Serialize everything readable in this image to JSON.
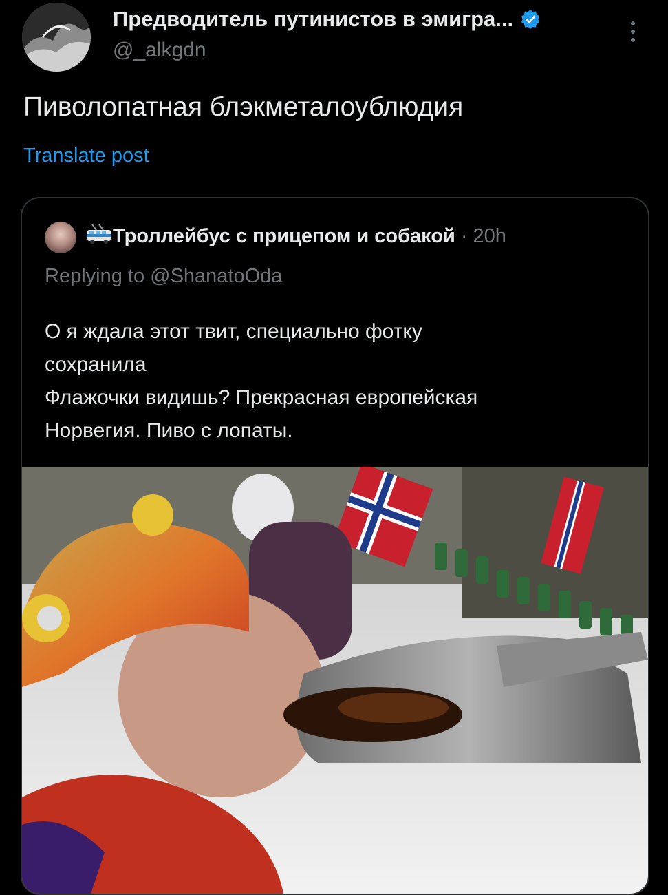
{
  "post": {
    "author_name": "Предводитель путинистов в эмигра...",
    "handle": "@_alkgdn",
    "text": "Пиволопатная блэкметалоублюдия",
    "translate_label": "Translate post"
  },
  "quote": {
    "author_name": "Троллейбус с прицепом и собакой",
    "separator": "·",
    "time": "20h",
    "reply_line": "Replying to @ShanatoOda",
    "text_lines": [
      "О я ждала этот твит, специально фотку",
      "сохранила",
      "Флажочки видишь? Прекрасная европейская",
      "Норвегия. Пиво с лопаты."
    ]
  },
  "colors": {
    "background": "#000000",
    "text_primary": "#e7e9ea",
    "text_secondary": "#71767b",
    "link": "#1d9bf0",
    "verified_badge": "#1d9bf0",
    "card_border": "#2f3336"
  },
  "icons": {
    "verified": "verified-badge-icon",
    "more": "more-vertical-icon",
    "trolleybus": "trolleybus-emoji-icon"
  }
}
